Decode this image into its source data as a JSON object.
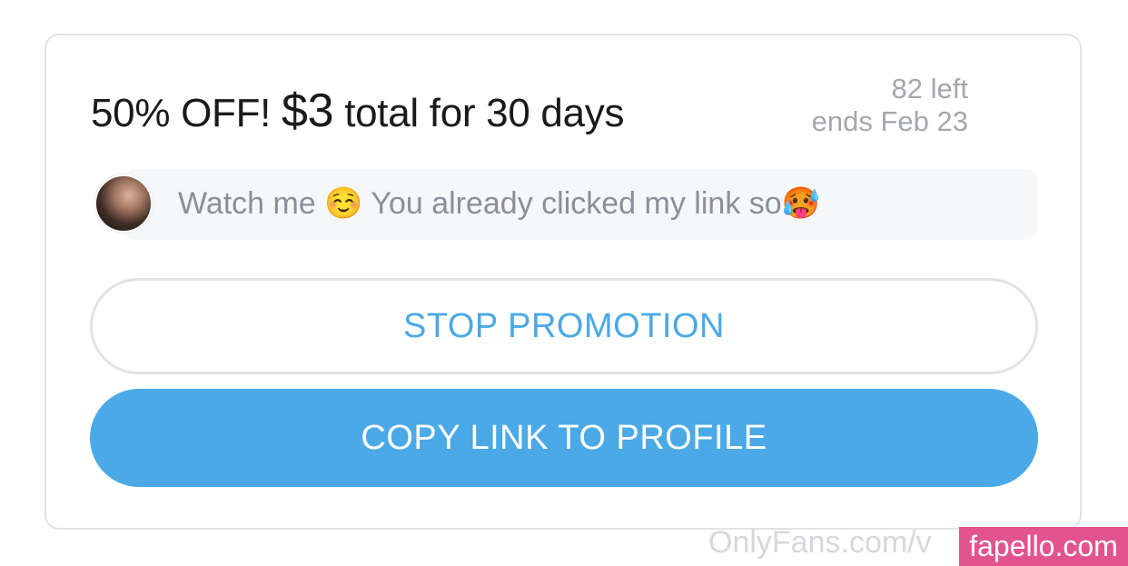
{
  "promo": {
    "title_prefix": "50% OFF! ",
    "price": "$3",
    "title_suffix": " total for 30 days",
    "remaining": "82 left",
    "ends": "ends Feb 23"
  },
  "message": {
    "text": "Watch me ☺️ You already clicked my link so🥵"
  },
  "buttons": {
    "stop_label": "STOP PROMOTION",
    "copy_label": "COPY LINK TO PROFILE"
  },
  "watermarks": {
    "site": "OnlyFans.com/v",
    "badge": "fapello.com"
  },
  "colors": {
    "accent": "#4aa9e6",
    "border": "#e2e3e6",
    "badge": "#e3538f"
  }
}
